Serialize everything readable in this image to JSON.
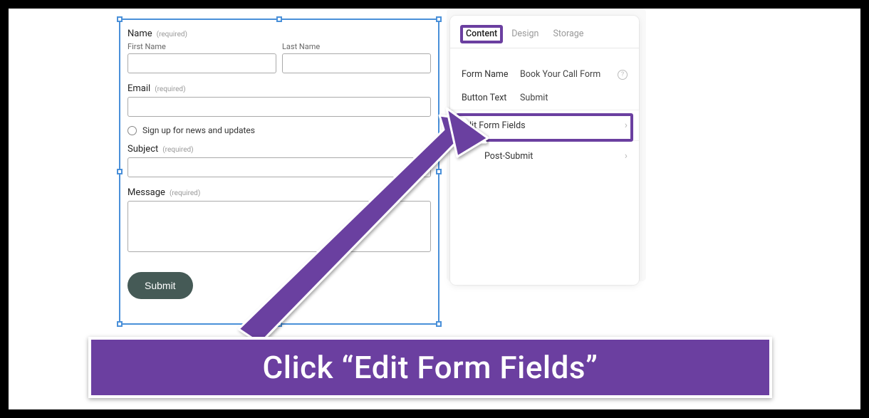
{
  "form": {
    "name": {
      "label": "Name",
      "required": "(required)"
    },
    "firstName": {
      "label": "First Name"
    },
    "lastName": {
      "label": "Last Name"
    },
    "email": {
      "label": "Email",
      "required": "(required)"
    },
    "signup": {
      "label": "Sign up for news and updates"
    },
    "subject": {
      "label": "Subject",
      "required": "(required)"
    },
    "message": {
      "label": "Message",
      "required": "(required)"
    },
    "submit": "Submit"
  },
  "panel": {
    "tabs": {
      "content": "Content",
      "design": "Design",
      "storage": "Storage"
    },
    "formName": {
      "label": "Form Name",
      "value": "Book Your Call Form"
    },
    "buttonText": {
      "label": "Button Text",
      "value": "Submit"
    },
    "editFormFields": "Edit Form Fields",
    "postSubmit": "Post-Submit"
  },
  "instruction": "Click “Edit Form Fields”"
}
